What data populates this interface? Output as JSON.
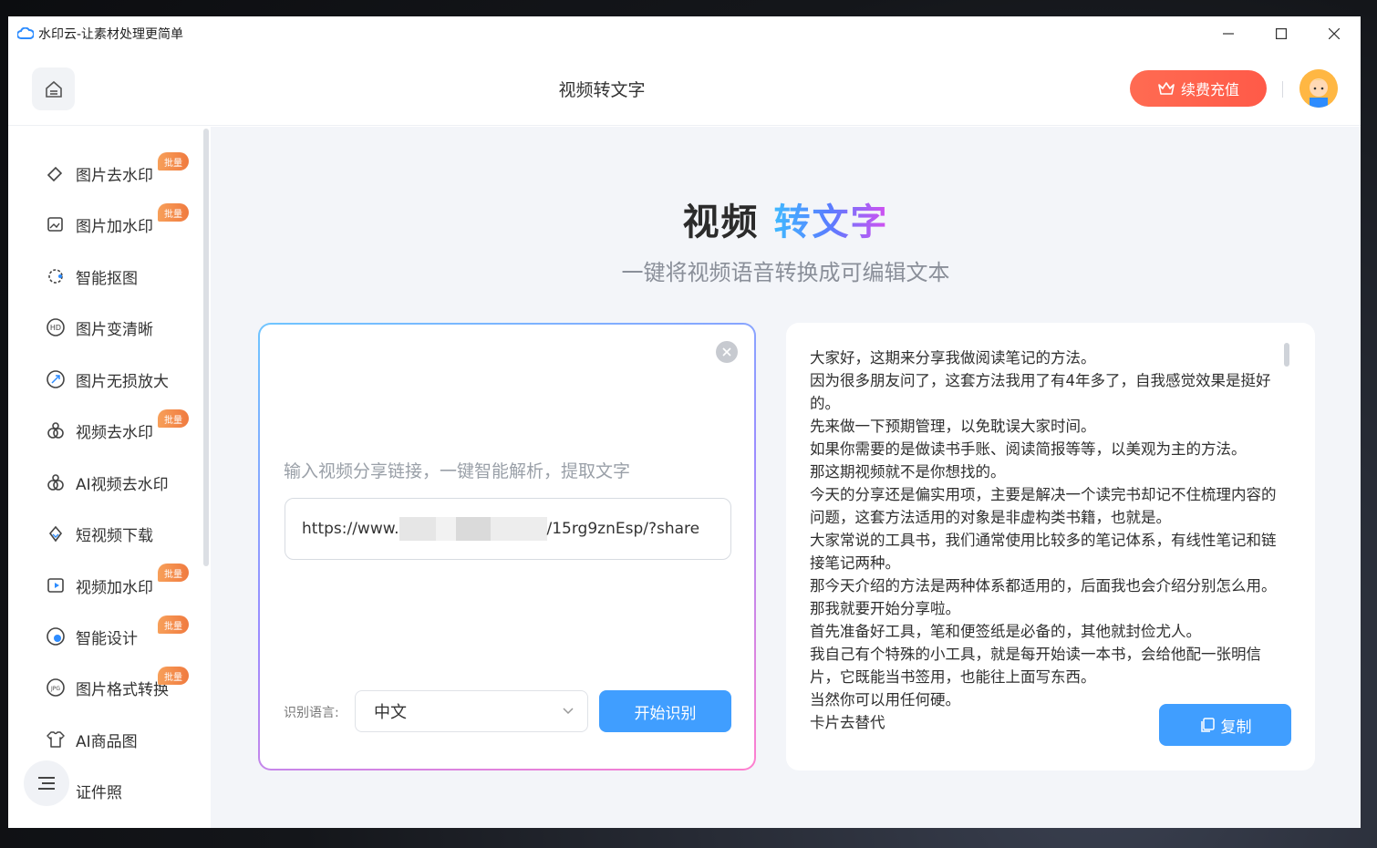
{
  "window": {
    "app_title": "水印云-让素材处理更简单",
    "controls": [
      "minimize-icon",
      "maximize-icon",
      "close-icon"
    ]
  },
  "header": {
    "page_title": "视频转文字",
    "recharge_label": "续费充值",
    "recharge_color": "#ff5f4a"
  },
  "sidebar": {
    "items": [
      {
        "label": "图片去水印",
        "icon": "eraser-icon",
        "badge": "批量"
      },
      {
        "label": "图片加水印",
        "icon": "image-add-icon",
        "badge": "批量"
      },
      {
        "label": "智能抠图",
        "icon": "cutout-icon",
        "badge": ""
      },
      {
        "label": "图片变清晰",
        "icon": "hd-icon",
        "badge": ""
      },
      {
        "label": "图片无损放大",
        "icon": "enlarge-icon",
        "badge": ""
      },
      {
        "label": "视频去水印",
        "icon": "video-eraser-icon",
        "badge": "批量"
      },
      {
        "label": "AI视频去水印",
        "icon": "ai-video-icon",
        "badge": ""
      },
      {
        "label": "短视频下载",
        "icon": "download-icon",
        "badge": ""
      },
      {
        "label": "视频加水印",
        "icon": "video-add-icon",
        "badge": "批量"
      },
      {
        "label": "智能设计",
        "icon": "design-icon",
        "badge": "批量"
      },
      {
        "label": "图片格式转换",
        "icon": "jpg-icon",
        "badge": "批量"
      },
      {
        "label": "AI商品图",
        "icon": "shirt-icon",
        "badge": ""
      },
      {
        "label": "证件照",
        "icon": "id-photo-icon",
        "badge": ""
      }
    ]
  },
  "main": {
    "hero_title_a": "视频",
    "hero_title_b": "转文字",
    "hero_subtitle": "一键将视频语音转换成可编辑文本",
    "input_hint": "输入视频分享链接，一键智能解析，提取文字",
    "url_prefix": "https://www.",
    "url_suffix": "/15rg9znEsp/?share",
    "lang_label": "识别语言:",
    "lang_value": "中文",
    "start_label": "开始识别",
    "copy_label": "复制",
    "accent_color": "#409eff",
    "result_lines": [
      "大家好，这期来分享我做阅读笔记的方法。",
      "因为很多朋友问了，这套方法我用了有4年多了，自我感觉效果是挺好的。",
      "先来做一下预期管理，以免耽误大家时间。",
      "如果你需要的是做读书手账、阅读简报等等，以美观为主的方法。",
      "那这期视频就不是你想找的。",
      "今天的分享还是偏实用项，主要是解决一个读完书却记不住梳理内容的问题，这套方法适用的对象是非虚构类书籍，也就是。",
      "大家常说的工具书，我们通常使用比较多的笔记体系，有线性笔记和链接笔记两种。",
      "那今天介绍的方法是两种体系都适用的，后面我也会介绍分别怎么用。",
      "那我就要开始分享啦。",
      "首先准备好工具，笔和便签纸是必备的，其他就封俭尤人。",
      "我自己有个特殊的小工具，就是每开始读一本书，会给他配一张明信片，它既能当书签用，也能往上面写东西。",
      "当然你可以用任何硬。",
      "卡片去替代"
    ]
  }
}
